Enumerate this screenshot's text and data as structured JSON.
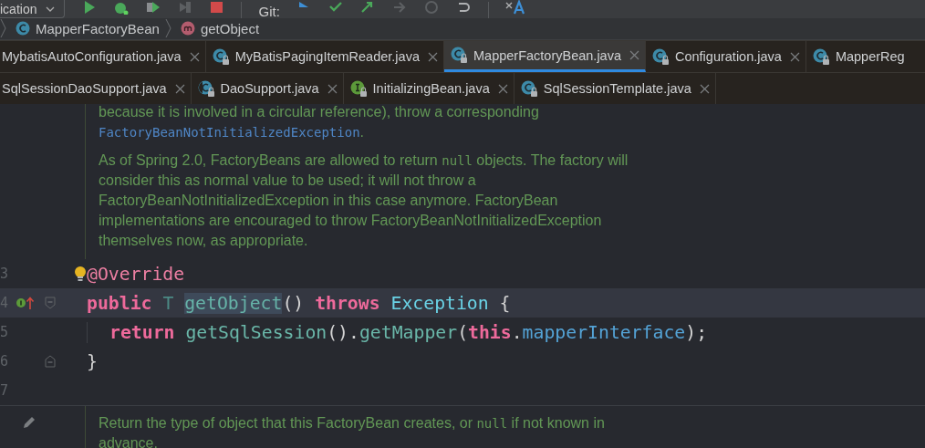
{
  "toolbar": {
    "run_config": "ication",
    "vcs_label": "Git:"
  },
  "breadcrumbs": [
    {
      "kind": "class",
      "label": "MapperFactoryBean"
    },
    {
      "kind": "method",
      "label": "getObject"
    }
  ],
  "tab_rows": [
    [
      {
        "label": "MybatisAutoConfiguration.java",
        "kind": "file",
        "selected": false
      },
      {
        "label": "MyBatisPagingItemReader.java",
        "kind": "class",
        "selected": false
      },
      {
        "label": "MapperFactoryBean.java",
        "kind": "class",
        "selected": true
      },
      {
        "label": "Configuration.java",
        "kind": "class",
        "selected": false
      },
      {
        "label": "MapperReg",
        "kind": "class",
        "selected": false
      }
    ],
    [
      {
        "label": "SqlSessionDaoSupport.java",
        "kind": "file",
        "selected": false
      },
      {
        "label": "DaoSupport.java",
        "kind": "abstract",
        "selected": false
      },
      {
        "label": "InitializingBean.java",
        "kind": "interface",
        "selected": false
      },
      {
        "label": "SqlSessionTemplate.java",
        "kind": "class",
        "selected": false
      }
    ]
  ],
  "editor": {
    "blocks": [
      {
        "kind": "doc",
        "paragraphs": [
          [
            {
              "kind": "text",
              "text": "because it is involved in a circular reference), throw a corresponding "
            },
            {
              "kind": "link",
              "text": "FactoryBeanNotInitializedException"
            },
            {
              "kind": "text",
              "text": "."
            }
          ],
          [
            {
              "kind": "text",
              "text": "As of Spring 2.0, FactoryBeans are allowed to return "
            },
            {
              "kind": "code",
              "text": "null"
            },
            {
              "kind": "text",
              "text": " objects. The factory will consider this as normal value to be used; it will not throw a FactoryBeanNotInitializedException in this case anymore. FactoryBean implementations are encouraged to throw FactoryBeanNotInitializedException themselves now, as appropriate."
            }
          ]
        ]
      },
      {
        "kind": "code",
        "lines": [
          {
            "number": "3",
            "current": false,
            "tokens": [
              {
                "kind": "annotation",
                "text": "@Override"
              }
            ]
          },
          {
            "number": "4",
            "current": true,
            "tokens": [
              {
                "kind": "keyword",
                "text": "public "
              },
              {
                "kind": "typeparam",
                "text": "T "
              },
              {
                "kind": "usage",
                "text": "getObject"
              },
              {
                "kind": "plain",
                "text": "() "
              },
              {
                "kind": "keyword",
                "text": "throws "
              },
              {
                "kind": "class",
                "text": "Exception"
              },
              {
                "kind": "plain",
                "text": " {"
              }
            ],
            "children": [
              {
                "number": "5",
                "current": false,
                "tokens": [
                  {
                    "kind": "keyword",
                    "text": "return "
                  },
                  {
                    "kind": "method",
                    "text": "getSqlSession"
                  },
                  {
                    "kind": "plain",
                    "text": "()."
                  },
                  {
                    "kind": "method",
                    "text": "getMapper"
                  },
                  {
                    "kind": "plain",
                    "text": "("
                  },
                  {
                    "kind": "keyword",
                    "text": "this"
                  },
                  {
                    "kind": "plain",
                    "text": "."
                  },
                  {
                    "kind": "field",
                    "text": "mapperInterface"
                  },
                  {
                    "kind": "plain",
                    "text": ");"
                  }
                ]
              }
            ]
          },
          {
            "number": "6",
            "current": false,
            "tokens": [
              {
                "kind": "plain",
                "text": "}"
              }
            ]
          },
          {
            "number": "7",
            "current": false
          }
        ]
      },
      {
        "kind": "doc",
        "paragraphs": [
          [
            {
              "kind": "text",
              "text": "Return the type of object that this FactoryBean creates, or "
            },
            {
              "kind": "code",
              "text": "null"
            },
            {
              "kind": "text",
              "text": " if not known in advance."
            }
          ]
        ]
      }
    ]
  }
}
